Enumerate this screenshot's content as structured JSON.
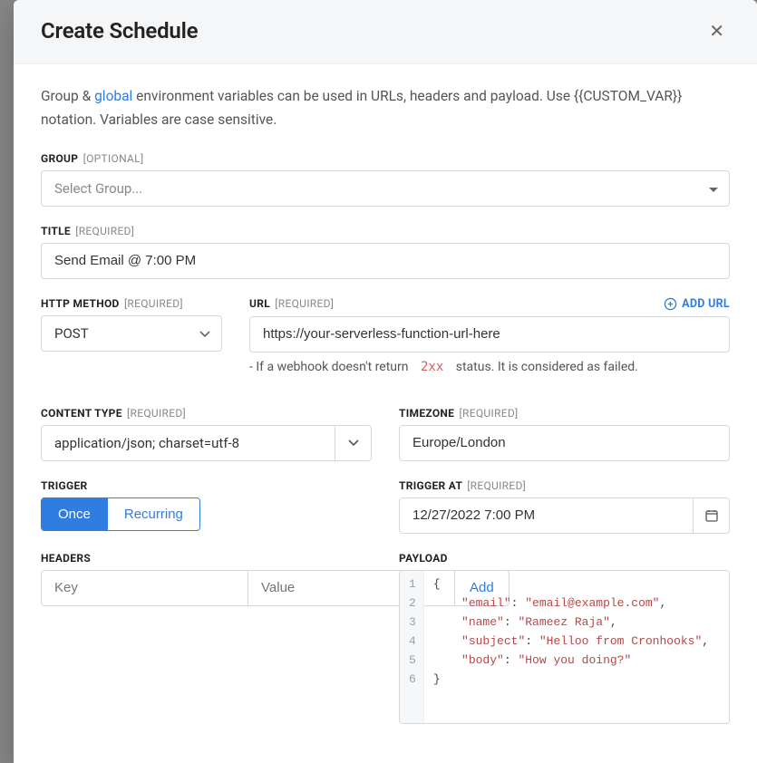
{
  "modal": {
    "title": "Create Schedule",
    "intro_before": "Group & ",
    "intro_link": "global",
    "intro_after": " environment variables can be used in URLs, headers and payload. Use {{CUSTOM_VAR}} notation. Variables are case sensitive."
  },
  "group": {
    "label": "GROUP",
    "qual": "[OPTIONAL]",
    "placeholder": "Select Group..."
  },
  "title_field": {
    "label": "TITLE",
    "qual": "[REQUIRED]",
    "value": "Send Email @ 7:00 PM"
  },
  "http_method": {
    "label": "HTTP METHOD",
    "qual": "[REQUIRED]",
    "value": "POST"
  },
  "url": {
    "label": "URL",
    "qual": "[REQUIRED]",
    "add_label": "ADD URL",
    "value": "https://your-serverless-function-url-here",
    "hint_before": "- If a webhook doesn't return ",
    "hint_code": "2xx",
    "hint_after": " status. It is considered as failed."
  },
  "content_type": {
    "label": "CONTENT TYPE",
    "qual": "[REQUIRED]",
    "value": "application/json; charset=utf-8"
  },
  "timezone": {
    "label": "TIMEZONE",
    "qual": "[REQUIRED]",
    "value": "Europe/London"
  },
  "trigger": {
    "label": "TRIGGER",
    "once": "Once",
    "recurring": "Recurring"
  },
  "trigger_at": {
    "label": "TRIGGER AT",
    "qual": "[REQUIRED]",
    "value": "12/27/2022 7:00 PM"
  },
  "headers": {
    "label": "HEADERS",
    "key_placeholder": "Key",
    "value_placeholder": "Value",
    "add_label": "Add"
  },
  "payload": {
    "label": "PAYLOAD",
    "gutter": [
      "1",
      "2",
      "3",
      "4",
      "5",
      "6"
    ],
    "lines": [
      [
        {
          "t": "punc",
          "v": "{"
        }
      ],
      [
        {
          "t": "indent",
          "v": "    "
        },
        {
          "t": "key",
          "v": "\"email\""
        },
        {
          "t": "punc",
          "v": ": "
        },
        {
          "t": "str",
          "v": "\"email@example.com\""
        },
        {
          "t": "punc",
          "v": ","
        }
      ],
      [
        {
          "t": "indent",
          "v": "    "
        },
        {
          "t": "key",
          "v": "\"name\""
        },
        {
          "t": "punc",
          "v": ": "
        },
        {
          "t": "str",
          "v": "\"Rameez Raja\""
        },
        {
          "t": "punc",
          "v": ","
        }
      ],
      [
        {
          "t": "indent",
          "v": "    "
        },
        {
          "t": "key",
          "v": "\"subject\""
        },
        {
          "t": "punc",
          "v": ": "
        },
        {
          "t": "str",
          "v": "\"Helloo from Cronhooks\""
        },
        {
          "t": "punc",
          "v": ","
        }
      ],
      [
        {
          "t": "indent",
          "v": "    "
        },
        {
          "t": "key",
          "v": "\"body\""
        },
        {
          "t": "punc",
          "v": ": "
        },
        {
          "t": "str",
          "v": "\"How you doing?\""
        }
      ],
      [
        {
          "t": "punc",
          "v": "}"
        }
      ]
    ]
  }
}
